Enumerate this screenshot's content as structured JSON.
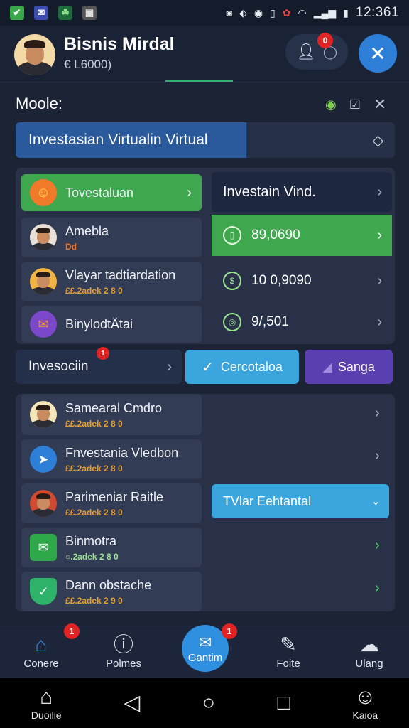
{
  "status_bar": {
    "time": "12:361"
  },
  "header": {
    "title": "Bisnis Mirdal",
    "subtitle": "€ L6000)",
    "badge": "0",
    "close_label": "✕"
  },
  "mode": {
    "label": "Moole:"
  },
  "tabs": {
    "active_label": "Investasian Virtualin Virtual"
  },
  "menu": {
    "primary": {
      "label": "Tovestaluan"
    },
    "items": [
      {
        "label": "Amebla",
        "sub": "Dd"
      },
      {
        "label": "Vlayar tadtiardation",
        "sub": "££.2adek 2 8 0"
      },
      {
        "label": "BinylodtÄtai",
        "sub": ""
      }
    ]
  },
  "values": {
    "header": "Investain Vind.",
    "rows": [
      {
        "value": "89,0690"
      },
      {
        "value": "10 0,9090"
      },
      {
        "value": "9/,501"
      }
    ]
  },
  "action_bar": {
    "label": "Invesociin",
    "badge": "1",
    "confirm": "Cercotaloa",
    "secondary": "Sanga"
  },
  "list": {
    "items": [
      {
        "label": "Samearal Cmdro",
        "sub": "££.2adek 2 8 0"
      },
      {
        "label": "Fnvestania Vledbon",
        "sub": "££.2adek 2 8 0"
      },
      {
        "label": "Parimeniar Raitle",
        "sub": "££.2adek 2 8 0"
      },
      {
        "label": "Binmotra",
        "sub": "○.2adek 2 8 0"
      },
      {
        "label": "Dann obstache",
        "sub": "££.2adek 2 9 0"
      }
    ],
    "dropdown_label": "TVlar Eehtantal"
  },
  "bottom_nav": [
    {
      "label": "Conere"
    },
    {
      "label": "Polmes"
    },
    {
      "label": "Gantim",
      "badge": "1"
    },
    {
      "label": "Foite"
    },
    {
      "label": "Ulang"
    }
  ],
  "nav_badge_home": "1",
  "system_bar": {
    "left_label": "Duoilie",
    "right_label": "Kaioa"
  },
  "colors": {
    "green": "#3fa74e",
    "blue": "#2d7fd8",
    "purple": "#5a3fb0",
    "cyan": "#3aa6dd"
  }
}
